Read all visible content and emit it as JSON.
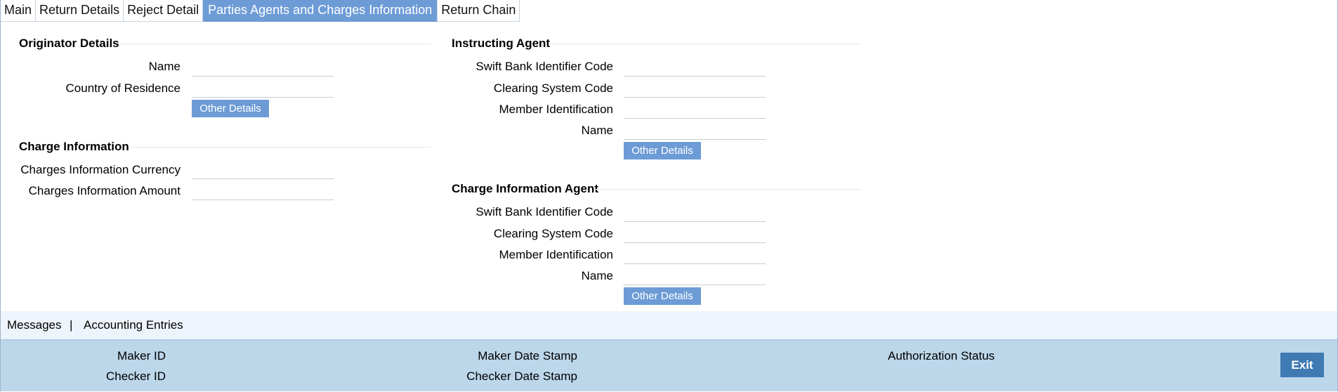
{
  "tabs": [
    {
      "label": "Main"
    },
    {
      "label": "Return Details"
    },
    {
      "label": "Reject Detail"
    },
    {
      "label": "Parties Agents and Charges Information",
      "active": true
    },
    {
      "label": "Return Chain"
    }
  ],
  "originator": {
    "title": "Originator Details",
    "name_label": "Name",
    "name_value": "",
    "country_label": "Country of Residence",
    "country_value": "",
    "other_details": "Other Details"
  },
  "charge_info": {
    "title": "Charge Information",
    "currency_label": "Charges Information Currency",
    "currency_value": "",
    "amount_label": "Charges Information Amount",
    "amount_value": ""
  },
  "instructing_agent": {
    "title": "Instructing Agent",
    "bic_label": "Swift Bank Identifier Code",
    "bic_value": "",
    "clearing_label": "Clearing System Code",
    "clearing_value": "",
    "member_label": "Member Identification",
    "member_value": "",
    "name_label": "Name",
    "name_value": "",
    "other_details": "Other Details"
  },
  "charge_agent": {
    "title": "Charge Information Agent",
    "bic_label": "Swift Bank Identifier Code",
    "bic_value": "",
    "clearing_label": "Clearing System Code",
    "clearing_value": "",
    "member_label": "Member Identification",
    "member_value": "",
    "name_label": "Name",
    "name_value": "",
    "other_details": "Other Details"
  },
  "links": {
    "messages": "Messages",
    "separator": "|",
    "accounting": "Accounting Entries"
  },
  "audit": {
    "maker_id": "Maker ID",
    "checker_id": "Checker ID",
    "maker_date": "Maker Date Stamp",
    "checker_date": "Checker Date Stamp",
    "auth_status": "Authorization Status",
    "exit": "Exit"
  },
  "colors": {
    "active_tab": "#6d9bd6",
    "button": "#6d9bd6",
    "footer": "#bcd6ea",
    "exit": "#3f7ab3"
  }
}
